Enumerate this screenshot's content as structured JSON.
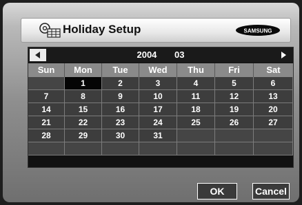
{
  "title": "Holiday Setup",
  "brand": "SAMSUNG",
  "calendar": {
    "year": "2004",
    "month": "03",
    "weekdays": [
      "Sun",
      "Mon",
      "Tue",
      "Wed",
      "Thu",
      "Fri",
      "Sat"
    ],
    "selected_day": "1",
    "weeks": [
      [
        "",
        "1",
        "2",
        "3",
        "4",
        "5",
        "6"
      ],
      [
        "7",
        "8",
        "9",
        "10",
        "11",
        "12",
        "13"
      ],
      [
        "14",
        "15",
        "16",
        "17",
        "18",
        "19",
        "20"
      ],
      [
        "21",
        "22",
        "23",
        "24",
        "25",
        "26",
        "27"
      ],
      [
        "28",
        "29",
        "30",
        "31",
        "",
        "",
        ""
      ],
      [
        "",
        "",
        "",
        "",
        "",
        "",
        ""
      ]
    ]
  },
  "buttons": {
    "ok": "OK",
    "cancel": "Cancel"
  },
  "icons": {
    "title": "holiday-calendar-icon",
    "prev": "arrow-left-icon",
    "next": "arrow-right-icon"
  }
}
